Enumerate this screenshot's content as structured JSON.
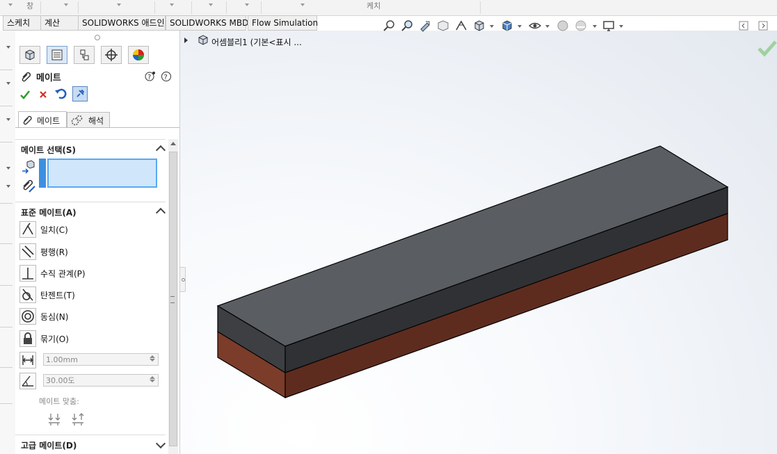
{
  "ribbon_top": {
    "items": [
      "창",
      "케치"
    ]
  },
  "command_tabs": [
    "스케치",
    "계산",
    "SOLIDWORKS 애드인",
    "SOLIDWORKS MBD",
    "Flow Simulation"
  ],
  "tree": {
    "item": "어셈블리1  (기본<표시 ..."
  },
  "property_manager": {
    "title": "메이트",
    "subtabs": [
      "메이트",
      "해석"
    ],
    "selection_section": "메이트 선택(S)",
    "standard_section": "표준 메이트(A)",
    "standard_mates": [
      "일치(C)",
      "평행(R)",
      "수직 관계(P)",
      "탄젠트(T)",
      "동심(N)",
      "묶기(O)"
    ],
    "distance_value": "1.00mm",
    "angle_value": "30.00도",
    "alignment_label": "메이트 맞춤:",
    "advanced_section": "고급 메이트(D)"
  },
  "colors": {
    "top_face": "#5a5d62",
    "front_upper": "#3d3f43",
    "side_upper": "#2f3134",
    "front_lower": "#7b3d2a",
    "side_lower": "#5e2c1e",
    "accept_green": "#2a9d2a",
    "cancel_red": "#d03020",
    "selection_box": "#cfe6fb"
  }
}
